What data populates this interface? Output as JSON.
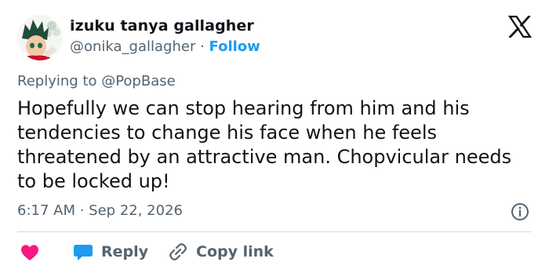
{
  "author": {
    "display_name": "izuku tanya gallagher",
    "handle": "@onika_gallagher",
    "separator": " · ",
    "follow_label": "Follow"
  },
  "reply_context": {
    "prefix": "Replying to ",
    "mention": "@PopBase"
  },
  "tweet": {
    "text": "Hopefully we can stop hearing from him and his tendencies to change his face when he feels threatened by an attractive man. Chopvicular needs to be locked up!"
  },
  "meta": {
    "time": "6:17 AM",
    "separator": " · ",
    "date": "Sep 22, 2026"
  },
  "actions": {
    "reply_label": "Reply",
    "copy_link_label": "Copy link"
  },
  "icons": {
    "brand": "x-logo-icon",
    "info": "info-icon",
    "like": "heart-icon",
    "reply": "reply-bubble-icon",
    "copy": "link-icon"
  },
  "colors": {
    "text": "#0f1419",
    "muted": "#536471",
    "accent": "#1d9bf0",
    "like": "#f91880",
    "divider": "#cfd9de"
  }
}
